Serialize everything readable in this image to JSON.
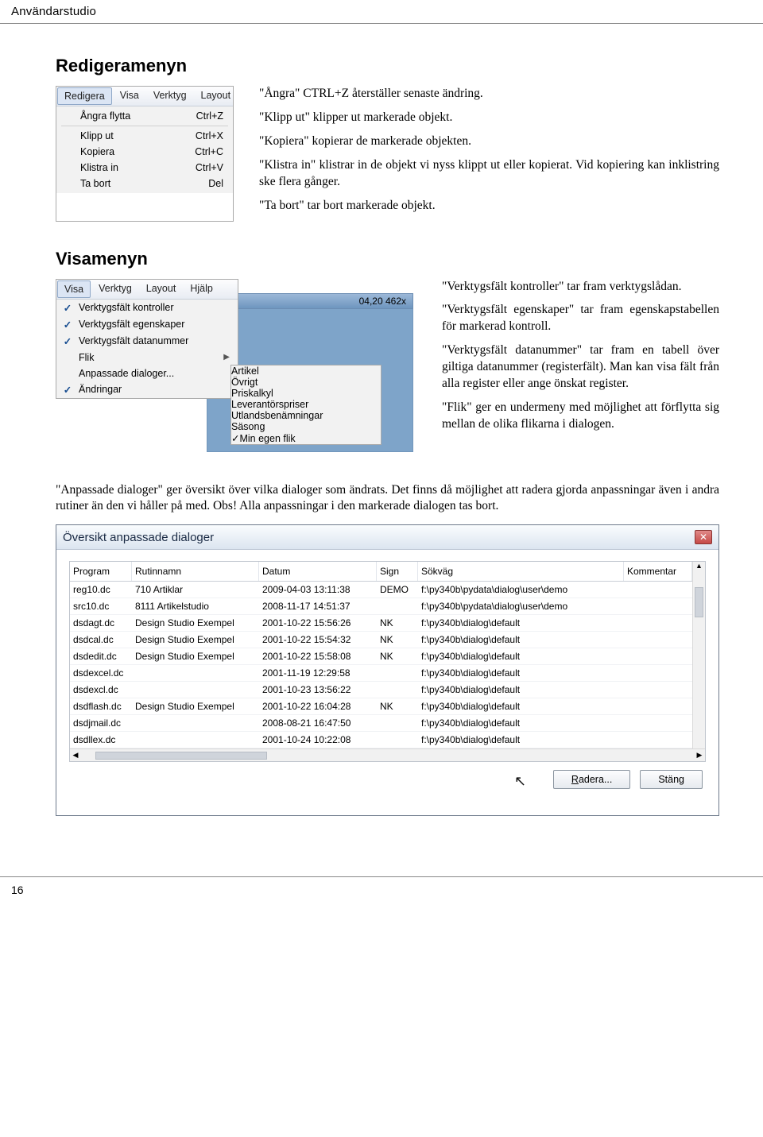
{
  "breadcrumb": "Användarstudio",
  "sections": {
    "redigera_title": "Redigeramenyn",
    "visa_title": "Visamenyn"
  },
  "redigera_menu": {
    "tabs": [
      "Redigera",
      "Visa",
      "Verktyg",
      "Layout"
    ],
    "items": [
      {
        "label": "Ångra flytta",
        "shortcut": "Ctrl+Z"
      },
      {
        "sep": true
      },
      {
        "label": "Klipp ut",
        "shortcut": "Ctrl+X"
      },
      {
        "label": "Kopiera",
        "shortcut": "Ctrl+C"
      },
      {
        "label": "Klistra in",
        "shortcut": "Ctrl+V"
      },
      {
        "label": "Ta bort",
        "shortcut": "Del"
      }
    ]
  },
  "redigera_text": {
    "p1": "\"Ångra\" CTRL+Z återställer senaste ändring.",
    "p2": "\"Klipp ut\" klipper ut markerade objekt.",
    "p3": "\"Kopiera\" kopierar de markerade objekten.",
    "p4": "\"Klistra in\" klistrar in de objekt vi nyss klippt ut eller kopierat. Vid kopiering kan inklistring ske            flera gånger.",
    "p5": "\"Ta bort\" tar bort markerade objekt."
  },
  "visa_menu": {
    "tabs": [
      "Visa",
      "Verktyg",
      "Layout",
      "Hjälp"
    ],
    "bluebar_text": "04,20  462x",
    "items": [
      {
        "check": true,
        "label": "Verktygsfält kontroller"
      },
      {
        "check": true,
        "label": "Verktygsfält egenskaper"
      },
      {
        "check": true,
        "label": "Verktygsfält datanummer"
      },
      {
        "sep": true
      },
      {
        "check": false,
        "label": "Flik",
        "sub": true
      },
      {
        "sep": true
      },
      {
        "check": false,
        "label": "Anpassade dialoger..."
      },
      {
        "check": true,
        "label": "Ändringar"
      }
    ],
    "submenu": [
      {
        "check": false,
        "label": "Artikel"
      },
      {
        "check": false,
        "label": "Övrigt"
      },
      {
        "check": false,
        "label": "Priskalkyl"
      },
      {
        "check": false,
        "label": "Leverantörspriser"
      },
      {
        "check": false,
        "label": "Utlandsbenämningar"
      },
      {
        "check": false,
        "label": "Säsong"
      },
      {
        "check": true,
        "label": "Min egen flik"
      }
    ]
  },
  "visa_text": {
    "p1": "\"Verktygsfält kontroller\"  tar fram verktygslådan.",
    "p2": "\"Verktygsfält egenskaper\" tar fram egenskapstabellen för markerad kontroll.",
    "p3": "\"Verktygsfält datanummer\" tar fram en tabell över giltiga datanummer (registerfält). Man kan visa fält från alla register eller ange önskat register.",
    "p4": "\"Flik\" ger en undermeny med möjlighet att förflytta sig mellan de olika flikarna i dialogen."
  },
  "after_visa": "\"Anpassade dialoger\" ger översikt över vilka dialoger som ändrats. Det finns då möjlighet att radera gjorda anpassningar även i andra rutiner än den vi håller på med. Obs! Alla anpassningar i den markerade dialogen tas bort.",
  "dialog": {
    "title": "Översikt anpassade dialoger",
    "headers": {
      "program": "Program",
      "rutin": "Rutinnamn",
      "datum": "Datum",
      "sign": "Sign",
      "sokvag": "Sökväg",
      "kommentar": "Kommentar"
    },
    "rows": [
      {
        "program": "reg10.dc",
        "rutin": "710 Artiklar",
        "datum": "2009-04-03 13:11:38",
        "sign": "DEMO",
        "sokvag": "f:\\py340b\\pydata\\dialog\\user\\demo"
      },
      {
        "program": "src10.dc",
        "rutin": "8111 Artikelstudio",
        "datum": "2008-11-17 14:51:37",
        "sign": "",
        "sokvag": "f:\\py340b\\pydata\\dialog\\user\\demo"
      },
      {
        "program": "dsdagt.dc",
        "rutin": "Design Studio Exempel",
        "datum": "2001-10-22 15:56:26",
        "sign": "NK",
        "sokvag": "f:\\py340b\\dialog\\default"
      },
      {
        "program": "dsdcal.dc",
        "rutin": "Design Studio Exempel",
        "datum": "2001-10-22 15:54:32",
        "sign": "NK",
        "sokvag": "f:\\py340b\\dialog\\default"
      },
      {
        "program": "dsdedit.dc",
        "rutin": "Design Studio Exempel",
        "datum": "2001-10-22 15:58:08",
        "sign": "NK",
        "sokvag": "f:\\py340b\\dialog\\default"
      },
      {
        "program": "dsdexcel.dc",
        "rutin": "",
        "datum": "2001-11-19 12:29:58",
        "sign": "",
        "sokvag": "f:\\py340b\\dialog\\default"
      },
      {
        "program": "dsdexcl.dc",
        "rutin": "",
        "datum": "2001-10-23 13:56:22",
        "sign": "",
        "sokvag": "f:\\py340b\\dialog\\default"
      },
      {
        "program": "dsdflash.dc",
        "rutin": "Design Studio Exempel",
        "datum": "2001-10-22 16:04:28",
        "sign": "NK",
        "sokvag": "f:\\py340b\\dialog\\default"
      },
      {
        "program": "dsdjmail.dc",
        "rutin": "",
        "datum": "2008-08-21 16:47:50",
        "sign": "",
        "sokvag": "f:\\py340b\\dialog\\default"
      },
      {
        "program": "dsdllex.dc",
        "rutin": "",
        "datum": "2001-10-24 10:22:08",
        "sign": "",
        "sokvag": "f:\\py340b\\dialog\\default"
      }
    ],
    "btn_delete": "Radera...",
    "btn_close": "Stäng"
  },
  "page_number": "16"
}
